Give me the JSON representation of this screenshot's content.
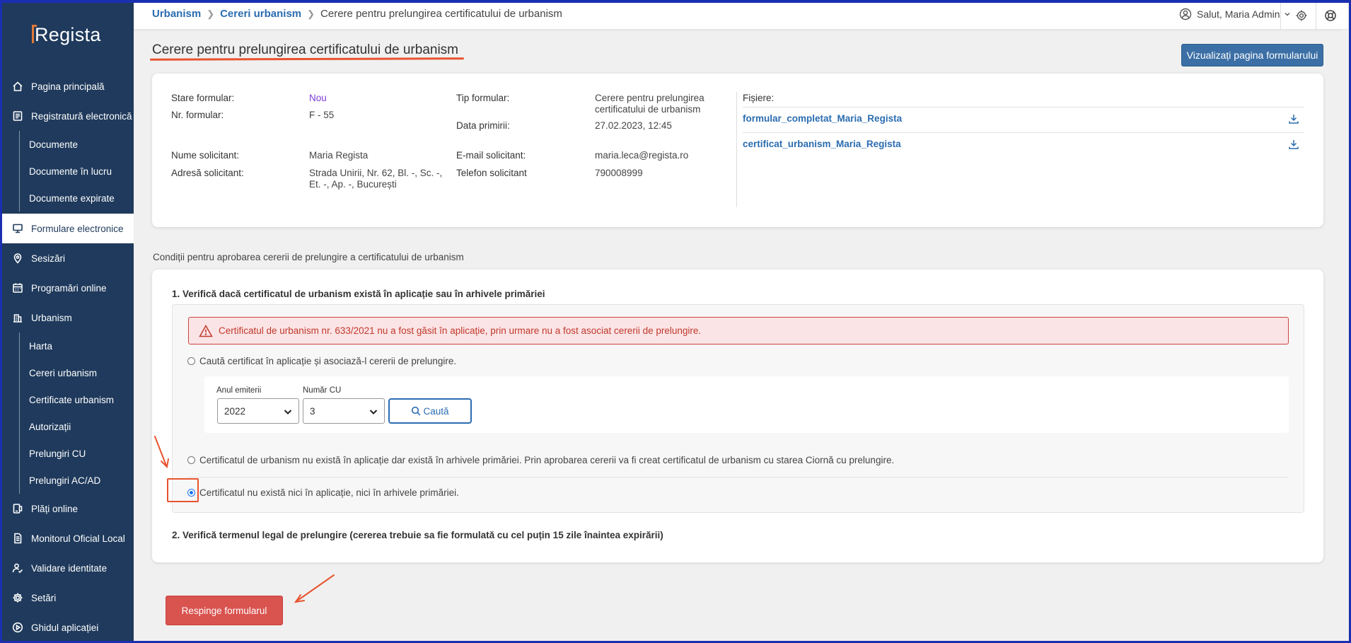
{
  "sidebar": {
    "logo": "Regista",
    "items": [
      {
        "label": "Pagina principală",
        "icon": "home-icon"
      },
      {
        "label": "Registratură electronică",
        "icon": "registry-icon"
      },
      {
        "label": "Documente",
        "sub": true
      },
      {
        "label": "Documente în lucru",
        "sub": true
      },
      {
        "label": "Documente expirate",
        "sub": true
      },
      {
        "label": "Formulare electronice",
        "icon": "form-icon",
        "active": true
      },
      {
        "label": "Sesizări",
        "icon": "pin-icon"
      },
      {
        "label": "Programări online",
        "icon": "calendar-icon"
      },
      {
        "label": "Urbanism",
        "icon": "building-icon"
      },
      {
        "label": "Harta",
        "sub": true
      },
      {
        "label": "Cereri urbanism",
        "sub": true
      },
      {
        "label": "Certificate urbanism",
        "sub": true
      },
      {
        "label": "Autorizații",
        "sub": true
      },
      {
        "label": "Prelungiri CU",
        "sub": true
      },
      {
        "label": "Prelungiri AC/AD",
        "sub": true
      },
      {
        "label": "Plăți online",
        "icon": "payment-icon"
      },
      {
        "label": "Monitorul Oficial Local",
        "icon": "document-icon"
      },
      {
        "label": "Validare identitate",
        "icon": "user-check-icon"
      },
      {
        "label": "Setări",
        "icon": "gear-icon"
      },
      {
        "label": "Ghidul aplicației",
        "icon": "play-circle-icon"
      }
    ]
  },
  "topbar": {
    "breadcrumb": [
      "Urbanism",
      "Cereri urbanism",
      "Cerere pentru prelungirea certificatului de urbanism"
    ],
    "user_greeting": "Salut, Maria Admin"
  },
  "page": {
    "title": "Cerere pentru prelungirea certificatului de urbanism",
    "view_button": "Vizualizați pagina formularului"
  },
  "info": {
    "status_label": "Stare formular:",
    "status_value": "Nou",
    "number_label": "Nr. formular:",
    "number_value": "F - 55",
    "applicant_label": "Nume solicitant:",
    "applicant_value": "Maria Regista",
    "address_label": "Adresă solicitant:",
    "address_line1": "Strada Unirii, Nr. 62, Bl. -, Sc. -,",
    "address_line2": "Et. -, Ap. -, București",
    "type_label": "Tip formular:",
    "type_line1": "Cerere pentru prelungirea",
    "type_line2": "certificatului de urbanism",
    "received_label": "Data primirii:",
    "received_value": "27.02.2023, 12:45",
    "email_label": "E-mail solicitant:",
    "email_value": "maria.leca@regista.ro",
    "phone_label": "Telefon solicitant",
    "phone_value": "790008999",
    "files_label": "Fișiere:",
    "files": [
      "formular_completat_Maria_Regista",
      "certificat_urbanism_Maria_Regista"
    ]
  },
  "conditions": {
    "caption": "Condiții pentru aprobarea cererii de prelungire a certificatului de urbanism",
    "step1": "1. Verifică dacă certificatul de urbanism există în aplicație sau în arhivele primăriei",
    "alert": "Certificatul de urbanism nr. 633/2021 nu a fost găsit în aplicație, prin urmare nu a fost asociat cererii de prelungire.",
    "option_search": "Caută certificat în aplicație și asociază-l cererii de prelungire.",
    "year_label": "Anul emiterii",
    "year_value": "2022",
    "cu_label": "Număr CU",
    "cu_value": "3",
    "search_button": "Caută",
    "option_archive": "Certificatul de urbanism nu există în aplicație dar există în arhivele primăriei. Prin aprobarea cererii va fi creat certificatul de urbanism cu starea Ciornă cu prelungire.",
    "option_none": "Certificatul nu există nici în aplicație, nici în arhivele primăriei.",
    "selected_option": "option_none",
    "step2": "2. Verifică termenul legal de prelungire (cererea trebuie sa fie formulată cu cel puțin 15 zile înaintea expirării)"
  },
  "actions": {
    "reject_button": "Respinge formularul"
  },
  "colors": {
    "sidebar_bg": "#1f3a5c",
    "primary_button": "#3b6fa5",
    "danger_button": "#d9534f",
    "annotation": "#e8532f",
    "status_new": "#7d3cd8",
    "link": "#2b6cb0"
  }
}
